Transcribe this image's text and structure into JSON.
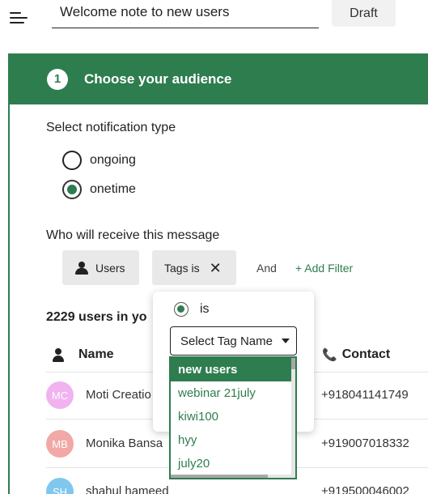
{
  "header": {
    "title_value": "Welcome note to new users",
    "draft_label": "Draft"
  },
  "step": {
    "number": "1",
    "title": "Choose your audience"
  },
  "notification_type": {
    "label": "Select notification type",
    "options": [
      {
        "label": "ongoing",
        "checked": false
      },
      {
        "label": "onetime",
        "checked": true
      }
    ]
  },
  "recipients": {
    "label": "Who will receive this message",
    "chips": [
      "Users",
      "Tags is"
    ],
    "and_label": "And",
    "add_filter_label": "+ Add Filter"
  },
  "users_count_label": "2229 users in yo",
  "table": {
    "headers": {
      "name": "Name",
      "contact": "Contact"
    },
    "rows": [
      {
        "initials": "MC",
        "name": "Moti Creatio",
        "contact": "+918041141749",
        "avatar_color": "#f0b3f0"
      },
      {
        "initials": "MB",
        "name": "Monika Bansa",
        "contact": "+919007018332",
        "avatar_color": "#f1a8a6"
      },
      {
        "initials": "SH",
        "name": "shahul hameed",
        "contact": "+919500046002",
        "avatar_color": "#7fc7ee"
      }
    ]
  },
  "tag_filter": {
    "operator_label": "is",
    "select_placeholder": "Select Tag Name",
    "options": [
      "new users",
      "webinar 21july",
      "kiwi100",
      "hyy",
      "july20"
    ],
    "highlighted": "new users"
  },
  "colors": {
    "primary": "#2e7d4f"
  }
}
